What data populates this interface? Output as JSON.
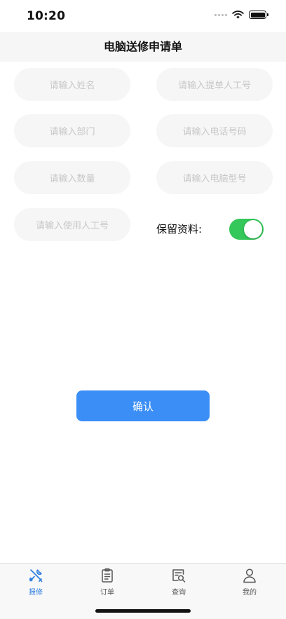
{
  "status_bar": {
    "time": "10:20"
  },
  "nav": {
    "title": "电脑送修申请单"
  },
  "form": {
    "name_placeholder": "请输入姓名",
    "submitter_id_placeholder": "请输入提单人工号",
    "department_placeholder": "请输入部门",
    "phone_placeholder": "请输入电话号码",
    "quantity_placeholder": "请输入数量",
    "model_placeholder": "请输入电脑型号",
    "user_id_placeholder": "请输入使用人工号",
    "keep_info_label": "保留资料:",
    "keep_info_on": true
  },
  "confirm_label": "确认",
  "tabs": [
    {
      "label": "报修",
      "icon": "tools-icon",
      "active": true
    },
    {
      "label": "订单",
      "icon": "clipboard-icon",
      "active": false
    },
    {
      "label": "查询",
      "icon": "search-doc-icon",
      "active": false
    },
    {
      "label": "我的",
      "icon": "person-icon",
      "active": false
    }
  ],
  "colors": {
    "accent": "#3a8ef6",
    "toggle_on": "#34c759",
    "tab_active": "#2e7de0"
  }
}
